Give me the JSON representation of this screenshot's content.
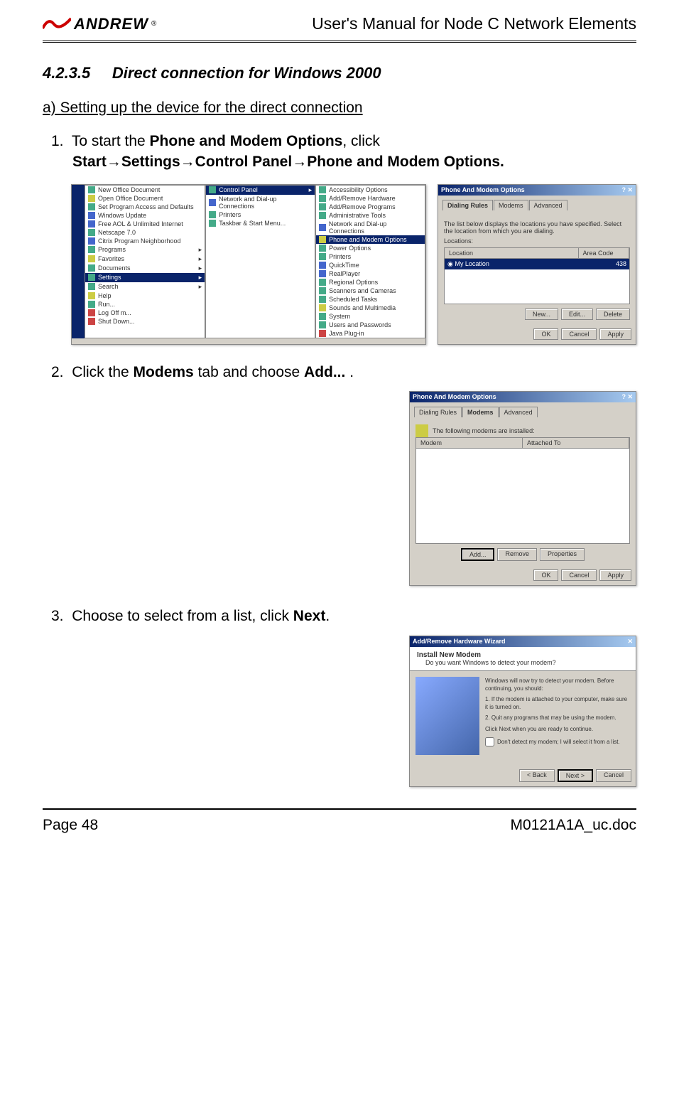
{
  "header": {
    "logo_text": "ANDREW",
    "logo_reg": "®",
    "doc_title": "User's Manual for Node C Network Elements"
  },
  "section": {
    "number": "4.2.3.5",
    "title": "Direct connection for Windows 2000",
    "subsection": "a) Setting up the device for the direct connection"
  },
  "steps": {
    "s1": {
      "num": "1.",
      "text_a": "To start the ",
      "bold_a": "Phone and Modem Options",
      "text_b": ", click",
      "bold_b": "Start→Settings→Control Panel→Phone and Modem Options."
    },
    "s2": {
      "num": "2.",
      "text_a": "Click the ",
      "bold_a": "Modems",
      "text_b": " tab and choose ",
      "bold_b": "Add...",
      "text_c": " ."
    },
    "s3": {
      "num": "3.",
      "text_a": "Choose to select from a list, click ",
      "bold_a": "Next",
      "text_b": "."
    }
  },
  "startmenu": {
    "col1": [
      "New Office Document",
      "Open Office Document",
      "Set Program Access and Defaults",
      "Windows Update",
      "Free AOL & Unlimited Internet",
      "Netscape 7.0",
      "Citrix Program Neighborhood",
      "Programs",
      "Favorites",
      "Documents",
      "Settings",
      "Search",
      "Help",
      "Run...",
      "Log Off m...",
      "Shut Down..."
    ],
    "col1_selected": "Settings",
    "col2": [
      "Control Panel",
      "Network and Dial-up Connections",
      "Printers",
      "Taskbar & Start Menu..."
    ],
    "col2_selected": "Control Panel",
    "col3": [
      "Accessibility Options",
      "Add/Remove Hardware",
      "Add/Remove Programs",
      "Administrative Tools",
      "Network and Dial-up Connections",
      "Phone and Modem Options",
      "Power Options",
      "Printers",
      "QuickTime",
      "RealPlayer",
      "Regional Options",
      "Scanners and Cameras",
      "Scheduled Tasks",
      "Sounds and Multimedia",
      "System",
      "Users and Passwords",
      "Java Plug-in"
    ],
    "col3_selected": "Phone and Modem Options"
  },
  "dialog1": {
    "title": "Phone And Modem Options",
    "tabs": [
      "Dialing Rules",
      "Modems",
      "Advanced"
    ],
    "active_tab": "Dialing Rules",
    "desc": "The list below displays the locations you have specified. Select the location from which you are dialing.",
    "label": "Locations:",
    "th1": "Location",
    "th2": "Area Code",
    "row_loc": "My Location",
    "row_code": "438",
    "btn_new": "New...",
    "btn_edit": "Edit...",
    "btn_del": "Delete",
    "btn_ok": "OK",
    "btn_cancel": "Cancel",
    "btn_apply": "Apply"
  },
  "dialog2": {
    "title": "Phone And Modem Options",
    "tabs": [
      "Dialing Rules",
      "Modems",
      "Advanced"
    ],
    "active_tab": "Modems",
    "desc": "The following modems are installed:",
    "th1": "Modem",
    "th2": "Attached To",
    "btn_add": "Add...",
    "btn_remove": "Remove",
    "btn_prop": "Properties",
    "btn_ok": "OK",
    "btn_cancel": "Cancel",
    "btn_apply": "Apply"
  },
  "dialog3": {
    "title": "Add/Remove Hardware Wizard",
    "subtitle": "Install New Modem",
    "question": "Do you want Windows to detect your modem?",
    "body1": "Windows will now try to detect your modem. Before continuing, you should:",
    "body2": "1. If the modem is attached to your computer, make sure it is turned on.",
    "body3": "2. Quit any programs that may be using the modem.",
    "body4": "Click Next when you are ready to continue.",
    "checkbox": "Don't detect my modem; I will select it from a list.",
    "btn_back": "< Back",
    "btn_next": "Next >",
    "btn_cancel": "Cancel"
  },
  "footer": {
    "page": "Page 48",
    "filename": "M0121A1A_uc.doc"
  }
}
